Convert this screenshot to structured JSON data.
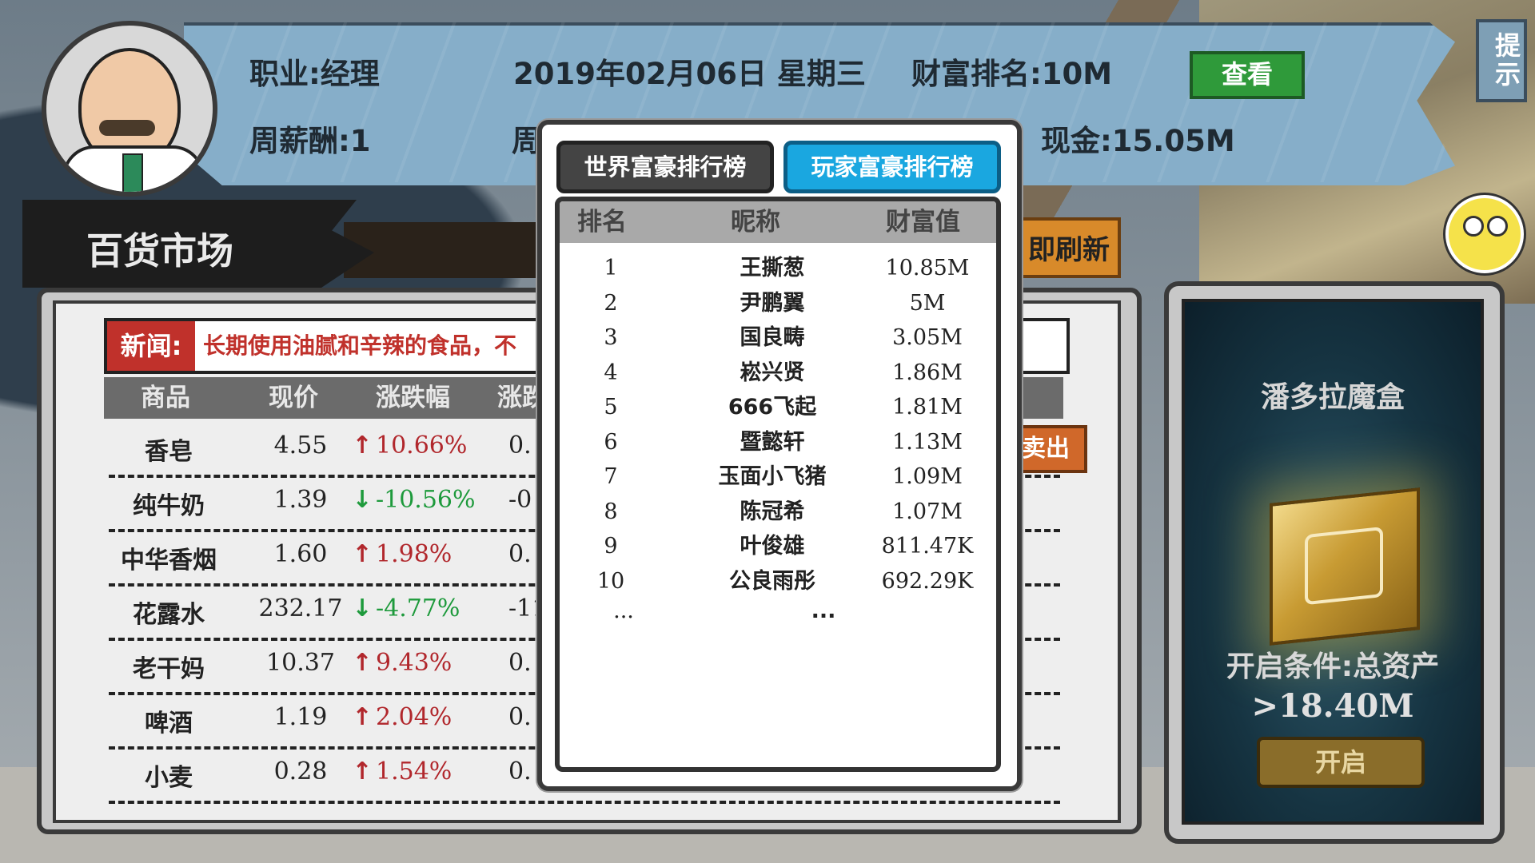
{
  "header": {
    "job": "职业:经理",
    "date": "2019年02月06日 星期三",
    "wealth_rank": "财富排名:10M",
    "view_button": "查看",
    "weekly_salary": "周薪酬:1",
    "partial_label": "周",
    "cash": "现金:15.05M",
    "hint_button": "提示"
  },
  "market": {
    "title": "百货市场",
    "refresh_button": "即刷新",
    "sell_button": "卖出",
    "news_label": "新闻:",
    "news_text": "长期使用油腻和辛辣的食品，不",
    "columns": [
      "商品",
      "现价",
      "涨跌幅",
      "涨跌"
    ],
    "rows": [
      {
        "name": "香皂",
        "price": "4.55",
        "arrow": "↑",
        "pct": "10.66%",
        "extra": "0."
      },
      {
        "name": "纯牛奶",
        "price": "1.39",
        "arrow": "↓",
        "pct": "-10.56%",
        "extra": "-0"
      },
      {
        "name": "中华香烟",
        "price": "1.60",
        "arrow": "↑",
        "pct": "1.98%",
        "extra": "0."
      },
      {
        "name": "花露水",
        "price": "232.17",
        "arrow": "↓",
        "pct": "-4.77%",
        "extra": "-11"
      },
      {
        "name": "老干妈",
        "price": "10.37",
        "arrow": "↑",
        "pct": "9.43%",
        "extra": "0."
      },
      {
        "name": "啤酒",
        "price": "1.19",
        "arrow": "↑",
        "pct": "2.04%",
        "extra": "0."
      },
      {
        "name": "小麦",
        "price": "0.28",
        "arrow": "↑",
        "pct": "1.54%",
        "extra": "0."
      }
    ]
  },
  "pandora": {
    "title": "潘多拉魔盒",
    "condition": "开启条件:总资产",
    "condition_value": ">18.40M",
    "open_button": "开启"
  },
  "leaderboard": {
    "tab_world": "世界富豪排行榜",
    "tab_player": "玩家富豪排行榜",
    "col_rank": "排名",
    "col_name": "昵称",
    "col_value": "财富值",
    "rows": [
      {
        "rank": "1",
        "name": "王撕葱",
        "value": "10.85M"
      },
      {
        "rank": "2",
        "name": "尹鹏翼",
        "value": "5M"
      },
      {
        "rank": "3",
        "name": "国良畴",
        "value": "3.05M"
      },
      {
        "rank": "4",
        "name": "崧兴贤",
        "value": "1.86M"
      },
      {
        "rank": "5",
        "name": "666飞起",
        "value": "1.81M"
      },
      {
        "rank": "6",
        "name": "暨懿轩",
        "value": "1.13M"
      },
      {
        "rank": "7",
        "name": "玉面小飞猪",
        "value": "1.09M"
      },
      {
        "rank": "8",
        "name": "陈冠希",
        "value": "1.07M"
      },
      {
        "rank": "9",
        "name": "叶俊雄",
        "value": "811.47K"
      },
      {
        "rank": "10",
        "name": "公良雨彤",
        "value": "692.29K"
      }
    ],
    "ellipsis_rank": "...",
    "ellipsis_name": "..."
  }
}
